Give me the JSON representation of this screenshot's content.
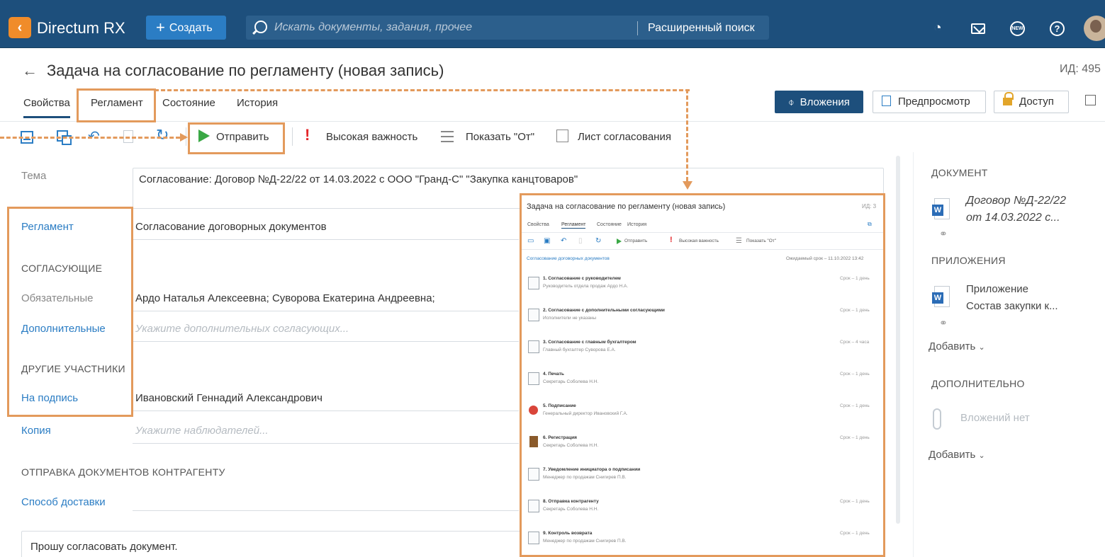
{
  "app": {
    "brand": "Directum RX",
    "logo_letter": "‹",
    "create_label": "Создать",
    "search_placeholder": "Искать документы, задания, прочее",
    "advanced_search": "Расширенный поиск"
  },
  "header": {
    "title": "Задача на согласование по регламенту (новая запись)",
    "id_label": "ИД: 495"
  },
  "tabs": [
    {
      "label": "Свойства"
    },
    {
      "label": "Регламент"
    },
    {
      "label": "Состояние"
    },
    {
      "label": "История"
    }
  ],
  "actions": {
    "attachments": "Вложения",
    "preview": "Предпросмотр",
    "access": "Доступ"
  },
  "toolbar": {
    "send": "Отправить",
    "importance": "Высокая важность",
    "show_from": "Показать \"От\"",
    "approval_sheet": "Лист согласования"
  },
  "form": {
    "topic_label": "Тема",
    "topic_value": "Согласование: Договор №Д-22/22 от 14.03.2022 с ООО \"Гранд-С\" \"Закупка канцтоваров\"",
    "regulation_label": "Регламент",
    "regulation_value": "Согласование договорных документов",
    "approvers_head": "СОГЛАСУЮЩИЕ",
    "required_label": "Обязательные",
    "required_value": "Ардо Наталья Алексеевна; Суворова Екатерина Андреевна;",
    "additional_label": "Дополнительные",
    "additional_placeholder": "Укажите дополнительных согласующих...",
    "others_head": "ДРУГИЕ УЧАСТНИКИ",
    "signer_label": "На подпись",
    "signer_value": "Ивановский Геннадий Александрович",
    "copy_label": "Копия",
    "copy_placeholder": "Укажите наблюдателей...",
    "sending_head": "ОТПРАВКА ДОКУМЕНТОВ КОНТРАГЕНТУ",
    "delivery_label": "Способ доставки",
    "note": "Прошу согласовать документ."
  },
  "right_panel": {
    "document_head": "ДОКУМЕНТ",
    "document_line1": "Договор №Д-22/22",
    "document_line2": "от 14.03.2022 с...",
    "attachments_head": "ПРИЛОЖЕНИЯ",
    "attachment_line1": "Приложение",
    "attachment_line2": "Состав закупки к...",
    "add_label": "Добавить",
    "additional_head": "ДОПОЛНИТЕЛЬНО",
    "no_attachments": "Вложений нет",
    "add_label_2": "Добавить"
  },
  "inset": {
    "title": "Задача на согласование по регламенту (новая запись)",
    "id": "ИД: 3",
    "tabs": [
      "Свойства",
      "Регламент",
      "Состояние",
      "История"
    ],
    "send": "Отправить",
    "importance": "Высокая важность",
    "show_from": "Показать \"От\"",
    "regulation_link": "Согласование договорных документов",
    "due": "Ожидаемый срок – 11.10.2022 13:42",
    "stages": [
      {
        "title": "1. Согласование с руководителем",
        "sub": "Руководитель отдела продаж Ардо Н.А.",
        "term": "Срок – 1 день"
      },
      {
        "title": "2. Согласование с дополнительными согласующими",
        "sub": "Исполнители не указаны",
        "term": "Срок – 1 день"
      },
      {
        "title": "3. Согласование с главным бухгалтером",
        "sub": "Главный бухгалтер Суворова Е.А.",
        "term": "Срок – 4 часа"
      },
      {
        "title": "4. Печать",
        "sub": "Секретарь Соболева Н.Н.",
        "term": "Срок – 1 день"
      },
      {
        "title": "5. Подписание",
        "sub": "Генеральный директор Ивановский Г.А.",
        "term": "Срок – 1 день"
      },
      {
        "title": "6. Регистрация",
        "sub": "Секретарь Соболева Н.Н.",
        "term": "Срок – 1 день"
      },
      {
        "title": "7. Уведомление инициатора о подписании",
        "sub": "Менеджер по продажам Снигирев П.В.",
        "term": ""
      },
      {
        "title": "8. Отправка контрагенту",
        "sub": "Секретарь Соболева Н.Н.",
        "term": "Срок – 1 день"
      },
      {
        "title": "9. Контроль возврата",
        "sub": "Менеджер по продажам Снигирев П.В.",
        "term": "Срок – 1 день"
      }
    ]
  }
}
